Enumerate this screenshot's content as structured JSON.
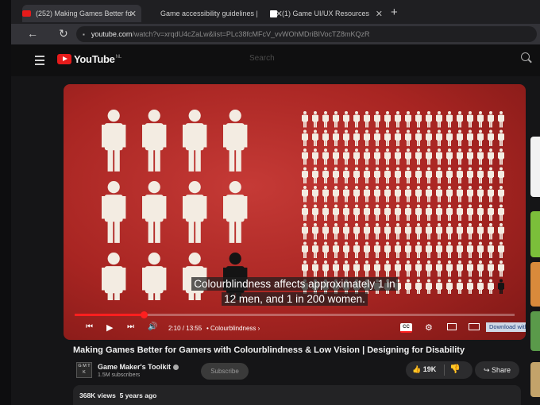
{
  "tabs": [
    {
      "title": "(252) Making Games Better fo",
      "favicon_color": "#e61b1b",
      "active": true
    },
    {
      "title": "Game accessibility guidelines |",
      "favicon_color": "",
      "active": false
    },
    {
      "title": "(1) Game UI/UX Resources",
      "favicon_color": "#ffffff",
      "active": false
    }
  ],
  "toolbar": {
    "url_host": "youtube.com",
    "url_path": "/watch?v=xrqdU4cZaLw&list=PLc38fcMFcV_vvWOhMDriBIVocTZ8mKQzR"
  },
  "youtube": {
    "logo_text": "YouTube",
    "logo_sup": "NL",
    "search_placeholder": "Search"
  },
  "video": {
    "caption_line1": "Colourblindness affects approximately 1 in",
    "caption_line2": "12 men, and 1 in 200 women.",
    "time": "2:10 / 13:55",
    "chapter": "• Colourblindness",
    "chapter_arrow": "›",
    "progress_fraction": 0.157,
    "download_button": "Download with",
    "title": "Making Games Better for Gamers with Colourblindness & Low Vision | Designing for Disability"
  },
  "channel": {
    "avatar_text": "G M T K",
    "name": "Game Maker's Toolkit",
    "subscribers": "1.5M subscribers",
    "subscribe_label": "Subscribe"
  },
  "actions": {
    "likes": "19K",
    "share_label": "Share"
  },
  "description": {
    "views": "368K views",
    "age": "5 years ago"
  },
  "colors": {
    "accent_red": "#ff1f1f",
    "figure": "#f3ece2",
    "highlight_figure": "#141414"
  }
}
